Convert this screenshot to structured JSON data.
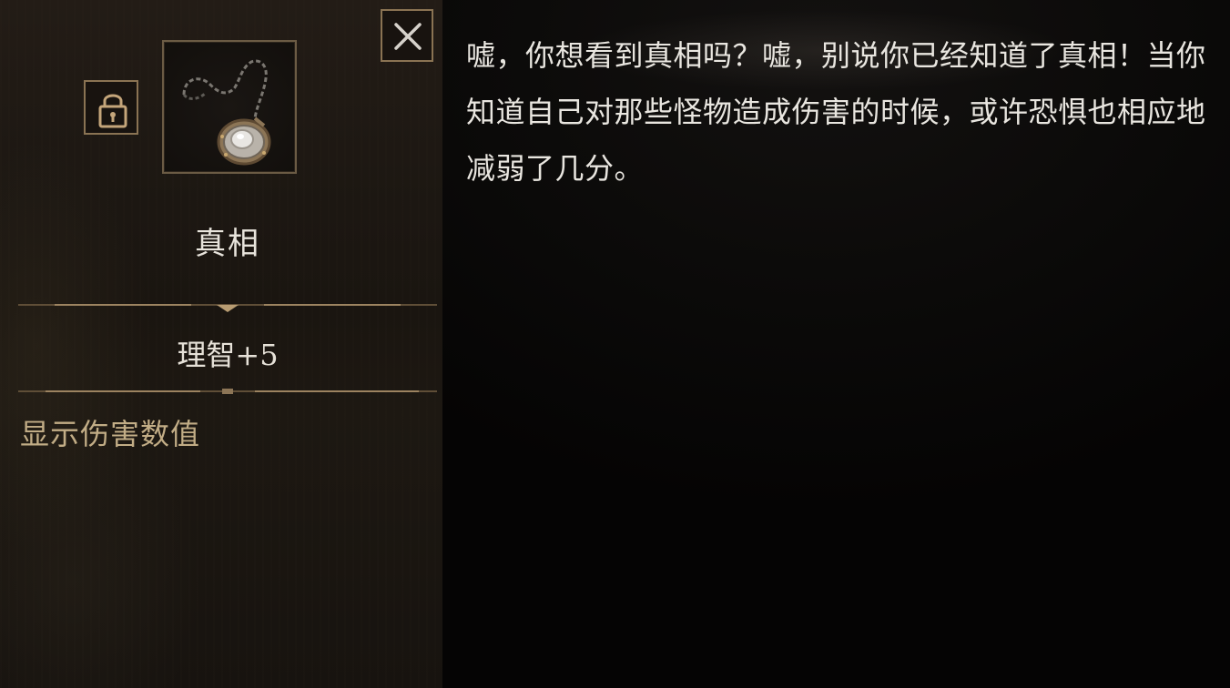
{
  "item": {
    "name": "真相",
    "image_icon": "pendant-necklace-icon",
    "stat": "理智+5",
    "effect": "显示伤害数值",
    "locked": true
  },
  "controls": {
    "close_icon": "close-x-icon",
    "lock_icon": "padlock-icon"
  },
  "description": {
    "text": "嘘，你想看到真相吗？嘘，别说你已经知道了真相！当你知道自己对那些怪物造成伤害的时候，或许恐惧也相应地减弱了几分。"
  },
  "colors": {
    "gold_border": "#8a7353",
    "effect_text": "#c2ad86",
    "main_text": "#e8e4dc"
  }
}
